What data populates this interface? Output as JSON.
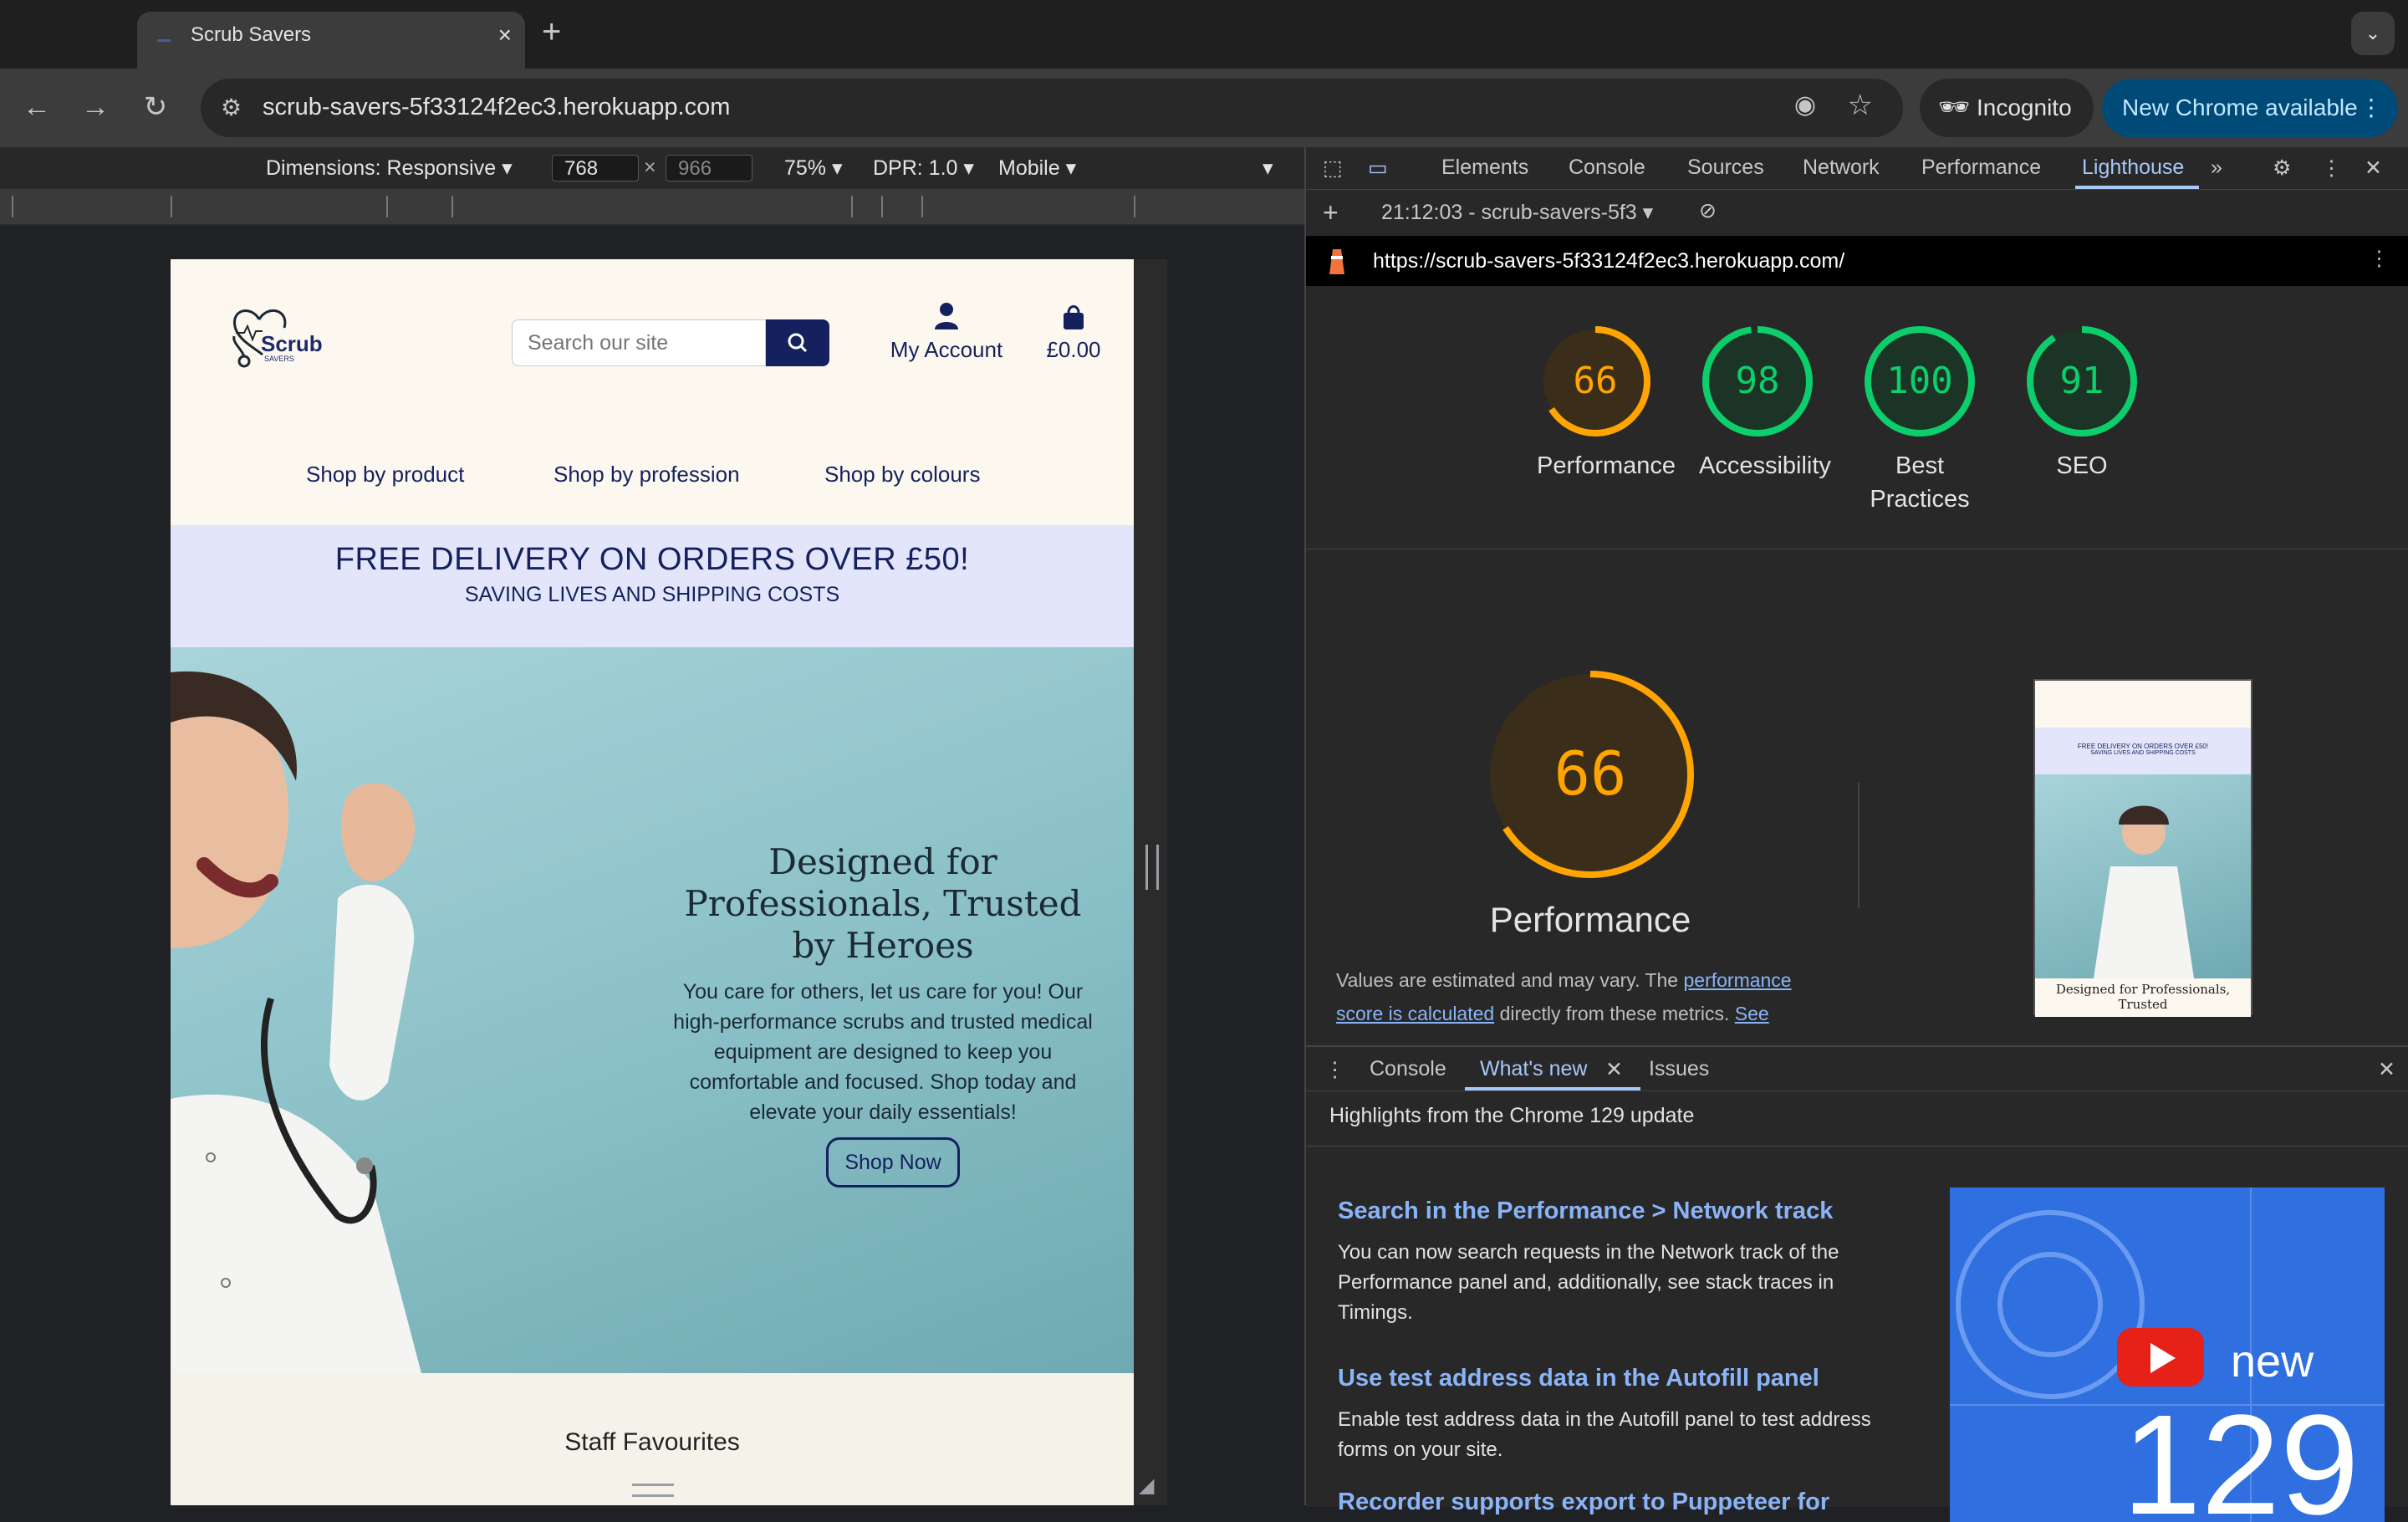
{
  "browser": {
    "tab_title": "Scrub Savers",
    "url": "scrub-savers-5f33124f2ec3.herokuapp.com",
    "incognito_label": "Incognito",
    "update_label": "New Chrome available"
  },
  "device_toolbar": {
    "dimensions_label": "Dimensions: Responsive",
    "width": "768",
    "height": "966",
    "zoom": "75%",
    "dpr": "DPR: 1.0",
    "mode": "Mobile"
  },
  "site": {
    "logo_text": "Scrub",
    "logo_sub": "SAVERS",
    "search_placeholder": "Search our site",
    "account_label": "My Account",
    "cart_total": "£0.00",
    "nav": [
      "Shop by product",
      "Shop by profession",
      "Shop by colours"
    ],
    "banner_title": "FREE DELIVERY ON ORDERS OVER £50!",
    "banner_subtitle": "SAVING LIVES AND SHIPPING COSTS",
    "hero_title": "Designed for Professionals, Trusted by Heroes",
    "hero_body": "You care for others, let us care for you! Our high-performance scrubs and trusted medical equipment are designed to keep you comfortable and focused. Shop today and elevate your daily essentials!",
    "hero_button": "Shop Now",
    "staff_heading": "Staff Favourites"
  },
  "devtools": {
    "tabs": [
      "Elements",
      "Console",
      "Sources",
      "Network",
      "Performance",
      "Lighthouse"
    ],
    "active_tab": "Lighthouse",
    "report_label": "21:12:03 - scrub-savers-5f3",
    "report_url": "https://scrub-savers-5f33124f2ec3.herokuapp.com/",
    "scores": [
      {
        "label": "Performance",
        "value": 66,
        "color": "#ffa400"
      },
      {
        "label": "Accessibility",
        "value": 98,
        "color": "#0cce6b"
      },
      {
        "label": "Best Practices",
        "value": 100,
        "color": "#0cce6b"
      },
      {
        "label": "SEO",
        "value": 91,
        "color": "#0cce6b"
      }
    ],
    "big_score": "66",
    "big_label": "Performance",
    "perf_note_prefix": "Values are estimated and may vary. The ",
    "perf_note_link": "performance score is calculated",
    "perf_note_middle": " directly from these metrics. ",
    "perf_note_link2": "See",
    "thumb_banner": "FREE DELIVERY ON ORDERS OVER £50!",
    "thumb_sub": "SAVING LIVES AND SHIPPING COSTS",
    "thumb_title": "Designed for Professionals, Trusted"
  },
  "drawer": {
    "tabs": [
      "Console",
      "What's new",
      "Issues"
    ],
    "highlights": "Highlights from the Chrome 129 update",
    "items": [
      {
        "title": "Search in the Performance > Network track",
        "body": "You can now search requests in the Network track of the Performance panel and, additionally, see stack traces in Timings."
      },
      {
        "title": "Use test address data in the Autofill panel",
        "body": "Enable test address data in the Autofill panel to test address forms on your site."
      },
      {
        "title": "Recorder supports export to Puppeteer for",
        "body": ""
      }
    ],
    "video_new": "new",
    "video_version": "129"
  }
}
